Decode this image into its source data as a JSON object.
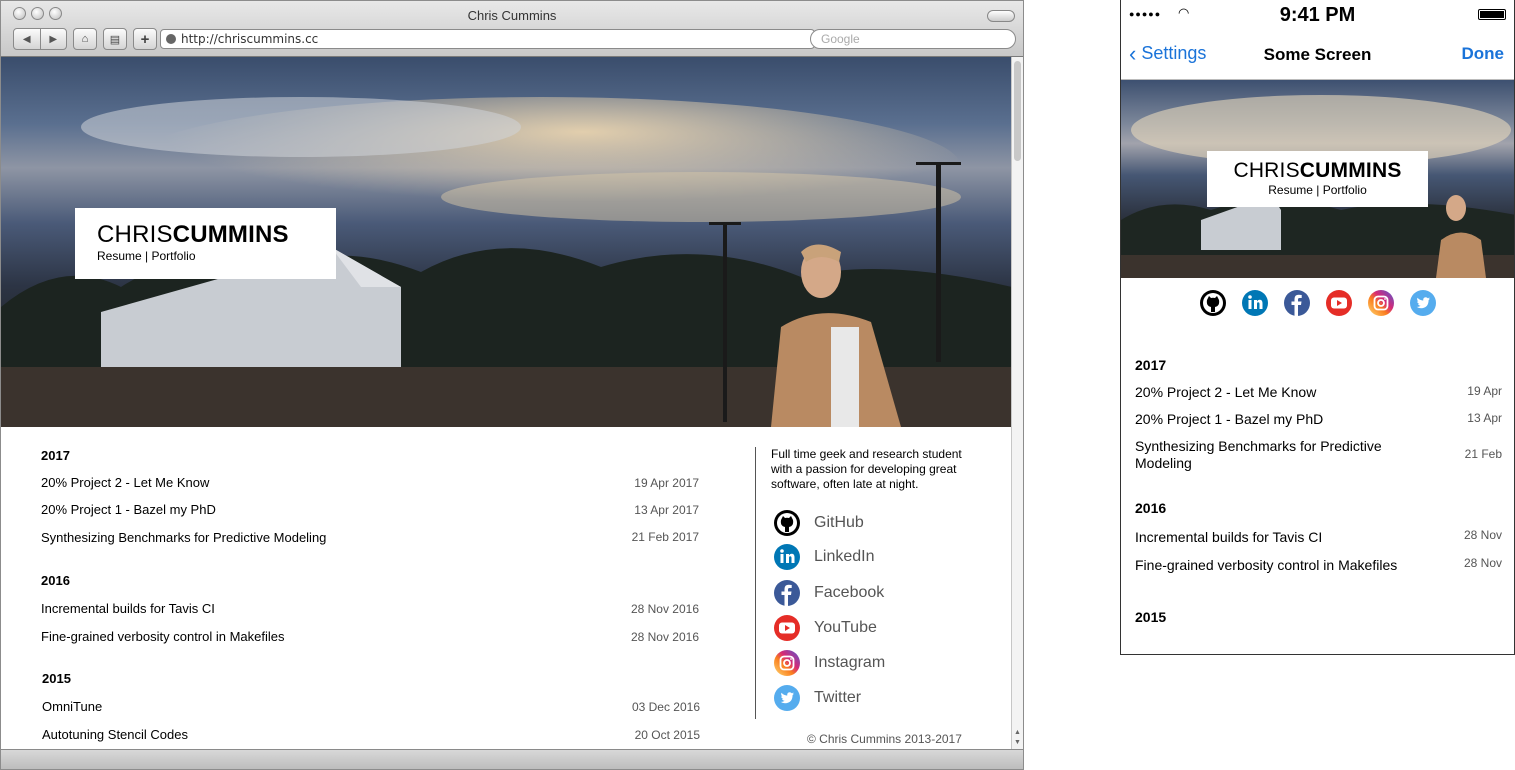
{
  "browser": {
    "window_title": "Chris Cummins",
    "url": "http://chriscummins.cc",
    "search_placeholder": "Google"
  },
  "site": {
    "name_first": "CHRIS",
    "name_last": "CUMMINS",
    "links": "Resume | Portfolio",
    "bio": "Full time geek and research student with a passion for developing great software, often late at night.",
    "copyright": "© Chris Cummins 2013-2017",
    "social": [
      {
        "label": "GitHub",
        "icon": "github-icon",
        "color": "#000000"
      },
      {
        "label": "LinkedIn",
        "icon": "linkedin-icon",
        "color": "#0077b5"
      },
      {
        "label": "Facebook",
        "icon": "facebook-icon",
        "color": "#3b5998"
      },
      {
        "label": "YouTube",
        "icon": "youtube-icon",
        "color": "#e52d27"
      },
      {
        "label": "Instagram",
        "icon": "instagram-icon",
        "color": "#c13584"
      },
      {
        "label": "Twitter",
        "icon": "twitter-icon",
        "color": "#55acee"
      }
    ],
    "years": [
      {
        "year": "2017",
        "posts": [
          {
            "title": "20% Project 2 - Let Me Know",
            "date": "19 Apr 2017"
          },
          {
            "title": "20% Project 1 - Bazel my PhD",
            "date": "13 Apr 2017"
          },
          {
            "title": "Synthesizing Benchmarks for Predictive Modeling",
            "date": "21 Feb 2017"
          }
        ]
      },
      {
        "year": "2016",
        "posts": [
          {
            "title": "Incremental builds for Tavis CI",
            "date": "28 Nov 2016"
          },
          {
            "title": "Fine-grained verbosity control in Makefiles",
            "date": "28 Nov 2016"
          }
        ]
      },
      {
        "year": "2015",
        "posts": [
          {
            "title": "OmniTune",
            "date": "03 Dec 2016"
          },
          {
            "title": "Autotuning Stencil Codes",
            "date": "20 Oct 2015"
          }
        ]
      }
    ]
  },
  "phone": {
    "time": "9:41 PM",
    "back_label": "Settings",
    "title": "Some Screen",
    "done_label": "Done",
    "accent": "#1a73d9",
    "years": [
      {
        "year": "2017",
        "posts": [
          {
            "title": "20% Project 2 - Let Me Know",
            "date": "19 Apr"
          },
          {
            "title": "20% Project 1 - Bazel my PhD",
            "date": "13 Apr"
          },
          {
            "title": "Synthesizing Benchmarks for Predictive Modeling",
            "date": "21 Feb"
          }
        ]
      },
      {
        "year": "2016",
        "posts": [
          {
            "title": "Incremental builds for Tavis CI",
            "date": "28 Nov"
          },
          {
            "title": "Fine-grained verbosity control in Makefiles",
            "date": "28 Nov"
          }
        ]
      },
      {
        "year": "2015",
        "posts": []
      }
    ]
  }
}
